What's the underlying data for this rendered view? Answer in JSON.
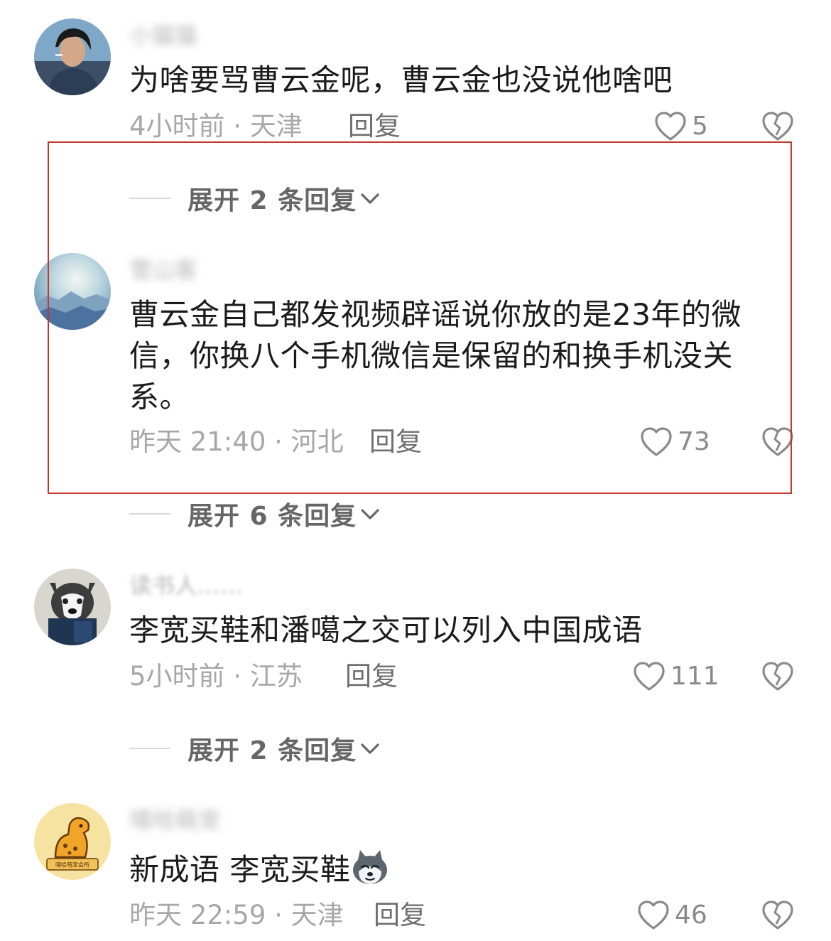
{
  "comments": [
    {
      "username": "小猫猫",
      "text": "为啥要骂曹云金呢，曹云金也没说他啥吧",
      "meta": "4小时前 · 天津",
      "reply_label": "回复",
      "likes": "5"
    },
    {
      "username": "雪山客",
      "text": "曹云金自己都发视频辟谣说你放的是23年的微信，你换八个手机微信是保留的和换手机没关系。",
      "meta": "昨天 21:40 · 河北",
      "reply_label": "回复",
      "likes": "73"
    },
    {
      "username": "读书人……",
      "text": "李宽买鞋和潘噶之交可以列入中国成语",
      "meta": "5小时前 · 江苏",
      "reply_label": "回复",
      "likes": "111"
    },
    {
      "username": "嘻哈萌宠",
      "text": "新成语 李宽买鞋",
      "meta": "昨天 22:59 · 天津",
      "reply_label": "回复",
      "likes": "46"
    }
  ],
  "expanders": [
    "展开 2 条回复",
    "展开 6 条回复",
    "展开 2 条回复"
  ],
  "avatar_badge_text": "嘻哈萌宠会所",
  "colors": {
    "highlight_border": "#c0392b",
    "meta_text": "#a7a7a7",
    "body_text": "#1b1b1b"
  },
  "icons": [
    "heart-outline-icon",
    "broken-heart-icon",
    "chevron-down-icon",
    "husky-emoji"
  ]
}
